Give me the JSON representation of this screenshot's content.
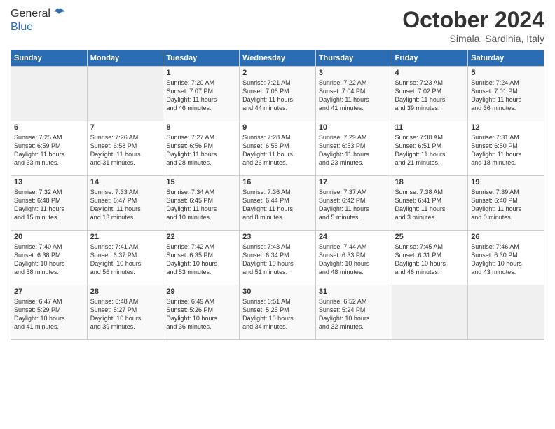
{
  "header": {
    "logo_line1": "General",
    "logo_line2": "Blue",
    "month": "October 2024",
    "location": "Simala, Sardinia, Italy"
  },
  "weekdays": [
    "Sunday",
    "Monday",
    "Tuesday",
    "Wednesday",
    "Thursday",
    "Friday",
    "Saturday"
  ],
  "weeks": [
    [
      {
        "day": "",
        "sunrise": "",
        "sunset": "",
        "daylight": ""
      },
      {
        "day": "",
        "sunrise": "",
        "sunset": "",
        "daylight": ""
      },
      {
        "day": "1",
        "sunrise": "Sunrise: 7:20 AM",
        "sunset": "Sunset: 7:07 PM",
        "daylight": "Daylight: 11 hours and 46 minutes."
      },
      {
        "day": "2",
        "sunrise": "Sunrise: 7:21 AM",
        "sunset": "Sunset: 7:06 PM",
        "daylight": "Daylight: 11 hours and 44 minutes."
      },
      {
        "day": "3",
        "sunrise": "Sunrise: 7:22 AM",
        "sunset": "Sunset: 7:04 PM",
        "daylight": "Daylight: 11 hours and 41 minutes."
      },
      {
        "day": "4",
        "sunrise": "Sunrise: 7:23 AM",
        "sunset": "Sunset: 7:02 PM",
        "daylight": "Daylight: 11 hours and 39 minutes."
      },
      {
        "day": "5",
        "sunrise": "Sunrise: 7:24 AM",
        "sunset": "Sunset: 7:01 PM",
        "daylight": "Daylight: 11 hours and 36 minutes."
      }
    ],
    [
      {
        "day": "6",
        "sunrise": "Sunrise: 7:25 AM",
        "sunset": "Sunset: 6:59 PM",
        "daylight": "Daylight: 11 hours and 33 minutes."
      },
      {
        "day": "7",
        "sunrise": "Sunrise: 7:26 AM",
        "sunset": "Sunset: 6:58 PM",
        "daylight": "Daylight: 11 hours and 31 minutes."
      },
      {
        "day": "8",
        "sunrise": "Sunrise: 7:27 AM",
        "sunset": "Sunset: 6:56 PM",
        "daylight": "Daylight: 11 hours and 28 minutes."
      },
      {
        "day": "9",
        "sunrise": "Sunrise: 7:28 AM",
        "sunset": "Sunset: 6:55 PM",
        "daylight": "Daylight: 11 hours and 26 minutes."
      },
      {
        "day": "10",
        "sunrise": "Sunrise: 7:29 AM",
        "sunset": "Sunset: 6:53 PM",
        "daylight": "Daylight: 11 hours and 23 minutes."
      },
      {
        "day": "11",
        "sunrise": "Sunrise: 7:30 AM",
        "sunset": "Sunset: 6:51 PM",
        "daylight": "Daylight: 11 hours and 21 minutes."
      },
      {
        "day": "12",
        "sunrise": "Sunrise: 7:31 AM",
        "sunset": "Sunset: 6:50 PM",
        "daylight": "Daylight: 11 hours and 18 minutes."
      }
    ],
    [
      {
        "day": "13",
        "sunrise": "Sunrise: 7:32 AM",
        "sunset": "Sunset: 6:48 PM",
        "daylight": "Daylight: 11 hours and 15 minutes."
      },
      {
        "day": "14",
        "sunrise": "Sunrise: 7:33 AM",
        "sunset": "Sunset: 6:47 PM",
        "daylight": "Daylight: 11 hours and 13 minutes."
      },
      {
        "day": "15",
        "sunrise": "Sunrise: 7:34 AM",
        "sunset": "Sunset: 6:45 PM",
        "daylight": "Daylight: 11 hours and 10 minutes."
      },
      {
        "day": "16",
        "sunrise": "Sunrise: 7:36 AM",
        "sunset": "Sunset: 6:44 PM",
        "daylight": "Daylight: 11 hours and 8 minutes."
      },
      {
        "day": "17",
        "sunrise": "Sunrise: 7:37 AM",
        "sunset": "Sunset: 6:42 PM",
        "daylight": "Daylight: 11 hours and 5 minutes."
      },
      {
        "day": "18",
        "sunrise": "Sunrise: 7:38 AM",
        "sunset": "Sunset: 6:41 PM",
        "daylight": "Daylight: 11 hours and 3 minutes."
      },
      {
        "day": "19",
        "sunrise": "Sunrise: 7:39 AM",
        "sunset": "Sunset: 6:40 PM",
        "daylight": "Daylight: 11 hours and 0 minutes."
      }
    ],
    [
      {
        "day": "20",
        "sunrise": "Sunrise: 7:40 AM",
        "sunset": "Sunset: 6:38 PM",
        "daylight": "Daylight: 10 hours and 58 minutes."
      },
      {
        "day": "21",
        "sunrise": "Sunrise: 7:41 AM",
        "sunset": "Sunset: 6:37 PM",
        "daylight": "Daylight: 10 hours and 56 minutes."
      },
      {
        "day": "22",
        "sunrise": "Sunrise: 7:42 AM",
        "sunset": "Sunset: 6:35 PM",
        "daylight": "Daylight: 10 hours and 53 minutes."
      },
      {
        "day": "23",
        "sunrise": "Sunrise: 7:43 AM",
        "sunset": "Sunset: 6:34 PM",
        "daylight": "Daylight: 10 hours and 51 minutes."
      },
      {
        "day": "24",
        "sunrise": "Sunrise: 7:44 AM",
        "sunset": "Sunset: 6:33 PM",
        "daylight": "Daylight: 10 hours and 48 minutes."
      },
      {
        "day": "25",
        "sunrise": "Sunrise: 7:45 AM",
        "sunset": "Sunset: 6:31 PM",
        "daylight": "Daylight: 10 hours and 46 minutes."
      },
      {
        "day": "26",
        "sunrise": "Sunrise: 7:46 AM",
        "sunset": "Sunset: 6:30 PM",
        "daylight": "Daylight: 10 hours and 43 minutes."
      }
    ],
    [
      {
        "day": "27",
        "sunrise": "Sunrise: 6:47 AM",
        "sunset": "Sunset: 5:29 PM",
        "daylight": "Daylight: 10 hours and 41 minutes."
      },
      {
        "day": "28",
        "sunrise": "Sunrise: 6:48 AM",
        "sunset": "Sunset: 5:27 PM",
        "daylight": "Daylight: 10 hours and 39 minutes."
      },
      {
        "day": "29",
        "sunrise": "Sunrise: 6:49 AM",
        "sunset": "Sunset: 5:26 PM",
        "daylight": "Daylight: 10 hours and 36 minutes."
      },
      {
        "day": "30",
        "sunrise": "Sunrise: 6:51 AM",
        "sunset": "Sunset: 5:25 PM",
        "daylight": "Daylight: 10 hours and 34 minutes."
      },
      {
        "day": "31",
        "sunrise": "Sunrise: 6:52 AM",
        "sunset": "Sunset: 5:24 PM",
        "daylight": "Daylight: 10 hours and 32 minutes."
      },
      {
        "day": "",
        "sunrise": "",
        "sunset": "",
        "daylight": ""
      },
      {
        "day": "",
        "sunrise": "",
        "sunset": "",
        "daylight": ""
      }
    ]
  ]
}
